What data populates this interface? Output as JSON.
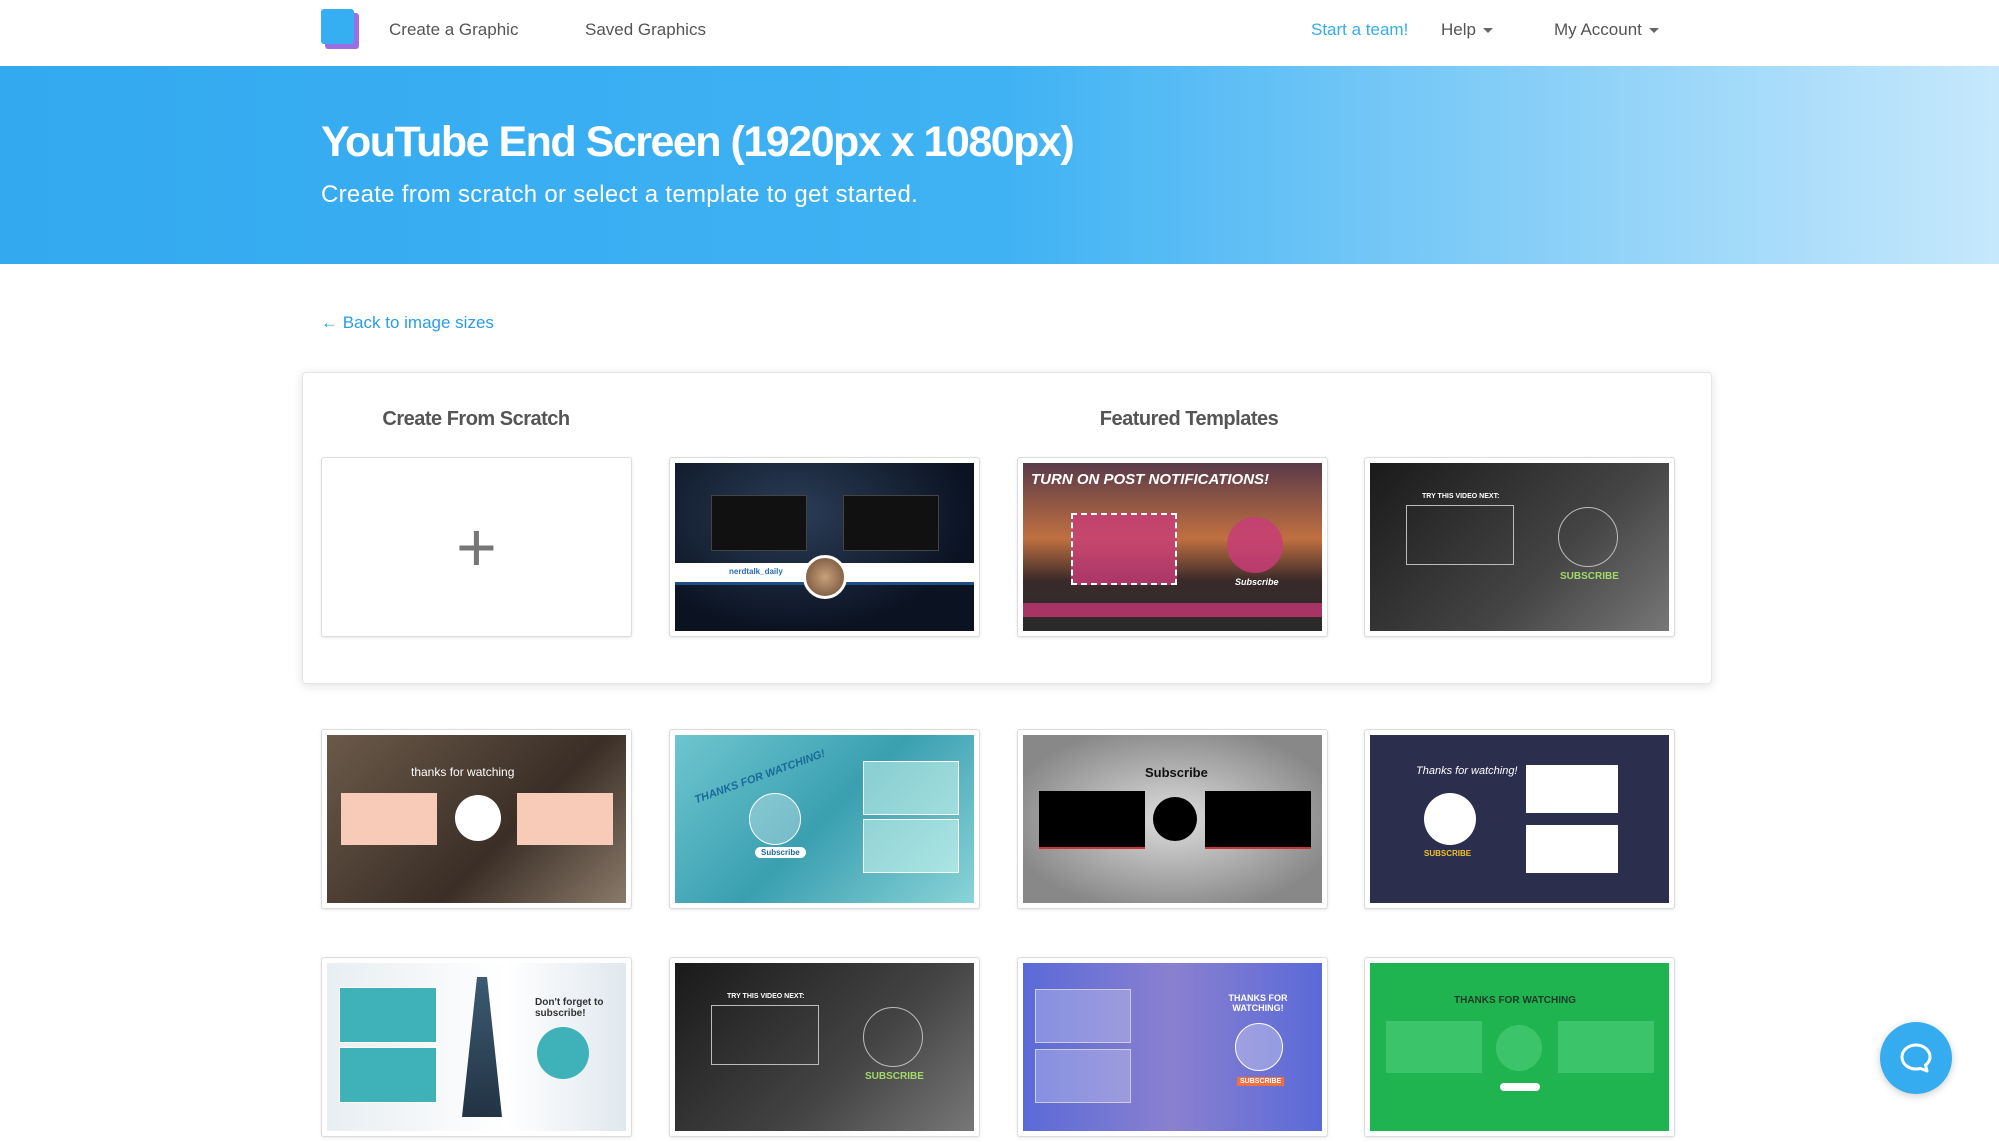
{
  "nav": {
    "create": "Create a Graphic",
    "saved": "Saved Graphics",
    "team": "Start a team!",
    "help": "Help",
    "account": "My Account"
  },
  "hero": {
    "title": "YouTube End Screen (1920px x 1080px)",
    "subtitle": "Create from scratch or select a template to get started."
  },
  "back": "← Back to image sizes",
  "sections": {
    "scratch": "Create From Scratch",
    "featured": "Featured Templates"
  },
  "scratch_icon": "plus-icon",
  "templates": [
    {
      "text": "nerdtalk_daily"
    },
    {
      "text": "TURN ON POST NOTIFICATIONS!",
      "sub": "Subscribe"
    },
    {
      "text": "TRY THIS VIDEO NEXT:",
      "sub": "SUBSCRIBE"
    },
    {
      "text": "thanks for watching"
    },
    {
      "text": "THANKS FOR WATCHING!",
      "sub": "Subscribe"
    },
    {
      "text": "Subscribe"
    },
    {
      "text": "Thanks for watching!",
      "sub": "SUBSCRIBE"
    },
    {
      "text": "Don't forget to subscribe!"
    },
    {
      "text": "TRY THIS VIDEO NEXT:",
      "sub": "SUBSCRIBE"
    },
    {
      "text": "THANKS FOR WATCHING!",
      "sub": "SUBSCRIBE"
    },
    {
      "text": "THANKS FOR WATCHING"
    }
  ],
  "colors": {
    "accent": "#35acf0",
    "link": "#2a9de8"
  },
  "help_icon": "chat-bubble-icon"
}
